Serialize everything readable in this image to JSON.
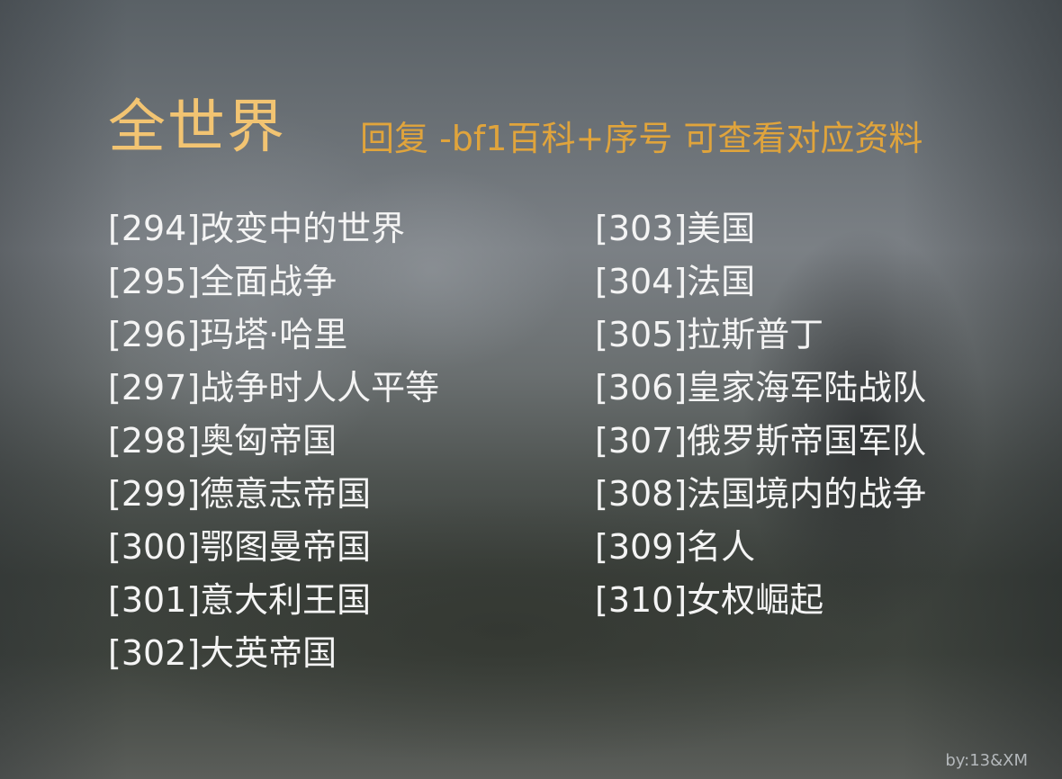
{
  "header": {
    "title": "全世界",
    "subtitle": "回复 -bf1百科+序号 可查看对应资料"
  },
  "list": {
    "left": [
      "[294]改变中的世界",
      "[295]全面战争",
      "[296]玛塔·哈里",
      "[297]战争时人人平等",
      "[298]奥匈帝国",
      "[299]德意志帝国",
      "[300]鄂图曼帝国",
      "[301]意大利王国",
      "[302]大英帝国"
    ],
    "right": [
      "[303]美国",
      "[304]法国",
      "[305]拉斯普丁",
      "[306]皇家海军陆战队",
      "[307]俄罗斯帝国军队",
      "[308]法国境内的战争",
      "[309]名人",
      "[310]女权崛起"
    ]
  },
  "footer": {
    "credit": "by:13&XM"
  },
  "colors": {
    "title": "#f2c472",
    "subtitle": "#e0a43c",
    "entry_text": "#f4f4f4"
  }
}
